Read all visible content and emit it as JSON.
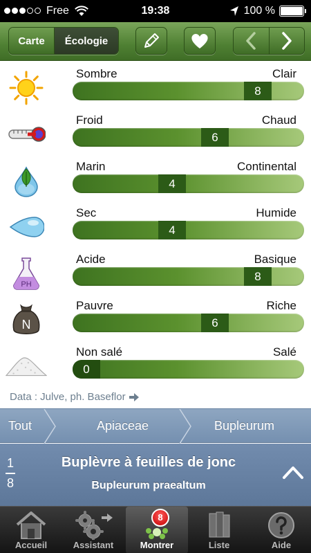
{
  "status_bar": {
    "signal_dots": 5,
    "signal_filled": 3,
    "carrier": "Free",
    "time": "19:38",
    "battery": "100 %"
  },
  "toolbar": {
    "segments": [
      {
        "label": "Carte"
      },
      {
        "label": "Écologie"
      }
    ],
    "selected_segment": "Écologie",
    "icons": [
      "pencil-icon",
      "heart-icon",
      "chevron-left-icon",
      "chevron-right-icon"
    ]
  },
  "ecology": [
    {
      "icon": "sun-icon",
      "min_label": "Sombre",
      "max_label": "Clair",
      "value": "8",
      "level": 8,
      "scale_max": 9
    },
    {
      "icon": "thermometer-icon",
      "min_label": "Froid",
      "max_label": "Chaud",
      "value": "6",
      "level": 6,
      "scale_max": 9
    },
    {
      "icon": "leaf-drop-icon",
      "min_label": "Marin",
      "max_label": "Continental",
      "value": "4",
      "level": 4,
      "scale_max": 9
    },
    {
      "icon": "water-drop-icon",
      "min_label": "Sec",
      "max_label": "Humide",
      "value": "4",
      "level": 4,
      "scale_max": 9
    },
    {
      "icon": "ph-flask-icon",
      "icon_text": "PH",
      "min_label": "Acide",
      "max_label": "Basique",
      "value": "8",
      "level": 8,
      "scale_max": 9
    },
    {
      "icon": "nitrogen-sack-icon",
      "icon_text": "N",
      "min_label": "Pauvre",
      "max_label": "Riche",
      "value": "6",
      "level": 6,
      "scale_max": 9
    },
    {
      "icon": "salt-pile-icon",
      "min_label": "Non salé",
      "max_label": "Salé",
      "value": "0",
      "level": 0,
      "scale_max": 9
    }
  ],
  "credits": {
    "text": "Data : Julve, ph. Baseflor",
    "icon": "arrow-right-icon"
  },
  "breadcrumb": [
    "Tout",
    "Apiaceae",
    "Bupleurum"
  ],
  "species": {
    "index": "1",
    "total": "8",
    "name": "Buplèvre à feuilles de jonc",
    "latin": "Bupleurum praealtum"
  },
  "tabs": [
    {
      "label": "Accueil",
      "icon": "house-icon"
    },
    {
      "label": "Assistant",
      "icon": "gears-icon"
    },
    {
      "label": "Montrer",
      "icon": "flower-icon",
      "badge": "8",
      "active": true
    },
    {
      "label": "Liste",
      "icon": "books-icon"
    },
    {
      "label": "Aide",
      "icon": "help-icon"
    }
  ],
  "colors": {
    "toolbar_green": "#4f8033",
    "bar_dark": "#2c5b17",
    "breadcrumb_blue": "#7590b0",
    "badge_red": "#c40000"
  }
}
